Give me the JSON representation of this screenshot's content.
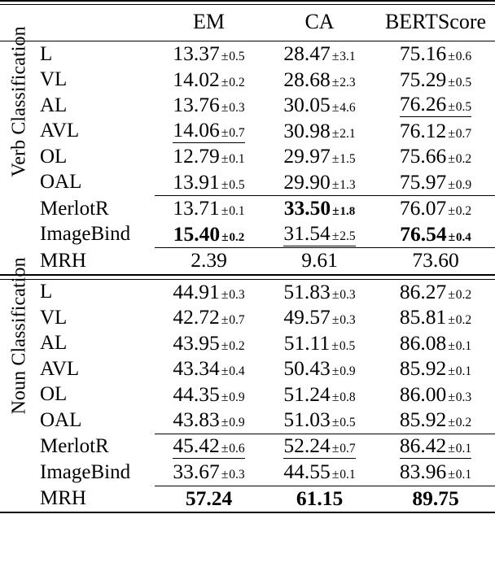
{
  "table": {
    "columns": [
      "EM",
      "CA",
      "BERTScore"
    ],
    "row_label_header": "",
    "sections": [
      {
        "side_label": "Verb Classification",
        "groups": [
          {
            "rows": [
              {
                "label": "L",
                "cells": [
                  {
                    "value": "13.37",
                    "error": "0.5",
                    "bold": false,
                    "underline": false
                  },
                  {
                    "value": "28.47",
                    "error": "3.1",
                    "bold": false,
                    "underline": false
                  },
                  {
                    "value": "75.16",
                    "error": "0.6",
                    "bold": false,
                    "underline": false
                  }
                ]
              },
              {
                "label": "VL",
                "cells": [
                  {
                    "value": "14.02",
                    "error": "0.2",
                    "bold": false,
                    "underline": false
                  },
                  {
                    "value": "28.68",
                    "error": "2.3",
                    "bold": false,
                    "underline": false
                  },
                  {
                    "value": "75.29",
                    "error": "0.5",
                    "bold": false,
                    "underline": false
                  }
                ]
              },
              {
                "label": "AL",
                "cells": [
                  {
                    "value": "13.76",
                    "error": "0.3",
                    "bold": false,
                    "underline": false
                  },
                  {
                    "value": "30.05",
                    "error": "4.6",
                    "bold": false,
                    "underline": false
                  },
                  {
                    "value": "76.26",
                    "error": "0.5",
                    "bold": false,
                    "underline": true
                  }
                ]
              },
              {
                "label": "AVL",
                "cells": [
                  {
                    "value": "14.06",
                    "error": "0.7",
                    "bold": false,
                    "underline": true
                  },
                  {
                    "value": "30.98",
                    "error": "2.1",
                    "bold": false,
                    "underline": false
                  },
                  {
                    "value": "76.12",
                    "error": "0.7",
                    "bold": false,
                    "underline": false
                  }
                ]
              },
              {
                "label": "OL",
                "cells": [
                  {
                    "value": "12.79",
                    "error": "0.1",
                    "bold": false,
                    "underline": false
                  },
                  {
                    "value": "29.97",
                    "error": "1.5",
                    "bold": false,
                    "underline": false
                  },
                  {
                    "value": "75.66",
                    "error": "0.2",
                    "bold": false,
                    "underline": false
                  }
                ]
              },
              {
                "label": "OAL",
                "cells": [
                  {
                    "value": "13.91",
                    "error": "0.5",
                    "bold": false,
                    "underline": false
                  },
                  {
                    "value": "29.90",
                    "error": "1.3",
                    "bold": false,
                    "underline": false
                  },
                  {
                    "value": "75.97",
                    "error": "0.9",
                    "bold": false,
                    "underline": false
                  }
                ]
              }
            ]
          },
          {
            "rows": [
              {
                "label": "MerlotR",
                "cells": [
                  {
                    "value": "13.71",
                    "error": "0.1",
                    "bold": false,
                    "underline": false
                  },
                  {
                    "value": "33.50",
                    "error": "1.8",
                    "bold": true,
                    "underline": false
                  },
                  {
                    "value": "76.07",
                    "error": "0.2",
                    "bold": false,
                    "underline": false
                  }
                ]
              },
              {
                "label": "ImageBind",
                "cells": [
                  {
                    "value": "15.40",
                    "error": "0.2",
                    "bold": true,
                    "underline": false
                  },
                  {
                    "value": "31.54",
                    "error": "2.5",
                    "bold": false,
                    "underline": true
                  },
                  {
                    "value": "76.54",
                    "error": "0.4",
                    "bold": true,
                    "underline": false
                  }
                ]
              }
            ]
          },
          {
            "rows": [
              {
                "label": "MRH",
                "cells": [
                  {
                    "value": "2.39",
                    "error": "",
                    "bold": false,
                    "underline": false
                  },
                  {
                    "value": "9.61",
                    "error": "",
                    "bold": false,
                    "underline": false
                  },
                  {
                    "value": "73.60",
                    "error": "",
                    "bold": false,
                    "underline": false
                  }
                ]
              }
            ]
          }
        ]
      },
      {
        "side_label": "Noun Classification",
        "groups": [
          {
            "rows": [
              {
                "label": "L",
                "cells": [
                  {
                    "value": "44.91",
                    "error": "0.3",
                    "bold": false,
                    "underline": false
                  },
                  {
                    "value": "51.83",
                    "error": "0.3",
                    "bold": false,
                    "underline": false
                  },
                  {
                    "value": "86.27",
                    "error": "0.2",
                    "bold": false,
                    "underline": false
                  }
                ]
              },
              {
                "label": "VL",
                "cells": [
                  {
                    "value": "42.72",
                    "error": "0.7",
                    "bold": false,
                    "underline": false
                  },
                  {
                    "value": "49.57",
                    "error": "0.3",
                    "bold": false,
                    "underline": false
                  },
                  {
                    "value": "85.81",
                    "error": "0.2",
                    "bold": false,
                    "underline": false
                  }
                ]
              },
              {
                "label": "AL",
                "cells": [
                  {
                    "value": "43.95",
                    "error": "0.2",
                    "bold": false,
                    "underline": false
                  },
                  {
                    "value": "51.11",
                    "error": "0.5",
                    "bold": false,
                    "underline": false
                  },
                  {
                    "value": "86.08",
                    "error": "0.1",
                    "bold": false,
                    "underline": false
                  }
                ]
              },
              {
                "label": "AVL",
                "cells": [
                  {
                    "value": "43.34",
                    "error": "0.4",
                    "bold": false,
                    "underline": false
                  },
                  {
                    "value": "50.43",
                    "error": "0.9",
                    "bold": false,
                    "underline": false
                  },
                  {
                    "value": "85.92",
                    "error": "0.1",
                    "bold": false,
                    "underline": false
                  }
                ]
              },
              {
                "label": "OL",
                "cells": [
                  {
                    "value": "44.35",
                    "error": "0.9",
                    "bold": false,
                    "underline": false
                  },
                  {
                    "value": "51.24",
                    "error": "0.8",
                    "bold": false,
                    "underline": false
                  },
                  {
                    "value": "86.00",
                    "error": "0.3",
                    "bold": false,
                    "underline": false
                  }
                ]
              },
              {
                "label": "OAL",
                "cells": [
                  {
                    "value": "43.83",
                    "error": "0.9",
                    "bold": false,
                    "underline": false
                  },
                  {
                    "value": "51.03",
                    "error": "0.5",
                    "bold": false,
                    "underline": false
                  },
                  {
                    "value": "85.92",
                    "error": "0.2",
                    "bold": false,
                    "underline": false
                  }
                ]
              }
            ]
          },
          {
            "rows": [
              {
                "label": "MerlotR",
                "cells": [
                  {
                    "value": "45.42",
                    "error": "0.6",
                    "bold": false,
                    "underline": true
                  },
                  {
                    "value": "52.24",
                    "error": "0.7",
                    "bold": false,
                    "underline": true
                  },
                  {
                    "value": "86.42",
                    "error": "0.1",
                    "bold": false,
                    "underline": true
                  }
                ]
              },
              {
                "label": "ImageBind",
                "cells": [
                  {
                    "value": "33.67",
                    "error": "0.3",
                    "bold": false,
                    "underline": false
                  },
                  {
                    "value": "44.55",
                    "error": "0.1",
                    "bold": false,
                    "underline": false
                  },
                  {
                    "value": "83.96",
                    "error": "0.1",
                    "bold": false,
                    "underline": false
                  }
                ]
              }
            ]
          },
          {
            "rows": [
              {
                "label": "MRH",
                "cells": [
                  {
                    "value": "57.24",
                    "error": "",
                    "bold": true,
                    "underline": false
                  },
                  {
                    "value": "61.15",
                    "error": "",
                    "bold": true,
                    "underline": false
                  },
                  {
                    "value": "89.75",
                    "error": "",
                    "bold": true,
                    "underline": false
                  }
                ]
              }
            ]
          }
        ]
      }
    ],
    "symbols": {
      "plus_minus": "±"
    }
  }
}
